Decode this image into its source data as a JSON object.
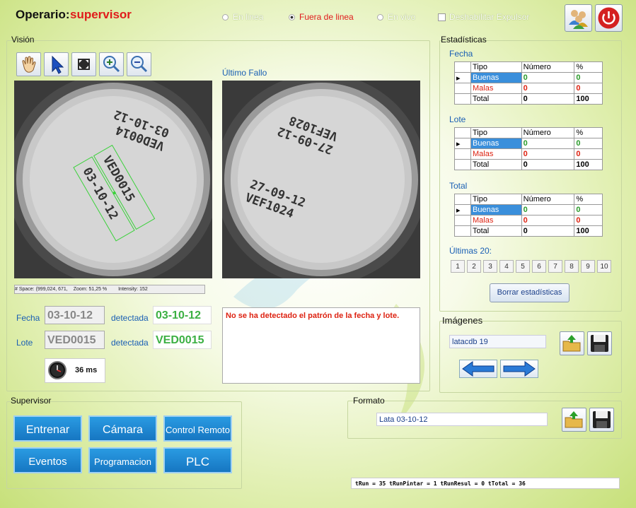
{
  "header": {
    "operator_label": "Operario:",
    "operator_name": "supervisor",
    "radios": [
      {
        "label": "En linea",
        "selected": false
      },
      {
        "label": "Fuera de linea",
        "selected": true
      },
      {
        "label": "En vivo",
        "selected": false
      }
    ],
    "checkbox_label": "Deshabilitar Expulsor"
  },
  "vision": {
    "title": "Visión",
    "last_fail_label": "Último Fallo",
    "status_bar": {
      "space": "# Space: (999,024, 671,",
      "zoom": "Zoom: 51,25 %",
      "intensity": "Intensity: 152"
    },
    "fecha_label": "Fecha",
    "fecha_value": "03-10-12",
    "detectada_label_1": "detectada",
    "fecha_detected": "03-10-12",
    "lote_label": "Lote",
    "lote_value": "VED0015",
    "detectada_label_2": "detectada",
    "lote_detected": "VED0015",
    "time": "36 ms",
    "message": "No se ha detectado el patrón de la fecha y lote."
  },
  "stats": {
    "title": "Estadísticas",
    "headers": [
      "Tipo",
      "Número",
      "%"
    ],
    "sections": [
      {
        "label": "Fecha",
        "rows": [
          [
            "Buenas",
            "0",
            "0"
          ],
          [
            "Malas",
            "0",
            "0"
          ],
          [
            "Total",
            "0",
            "100"
          ]
        ]
      },
      {
        "label": "Lote",
        "rows": [
          [
            "Buenas",
            "0",
            "0"
          ],
          [
            "Malas",
            "0",
            "0"
          ],
          [
            "Total",
            "0",
            "100"
          ]
        ]
      },
      {
        "label": "Total",
        "rows": [
          [
            "Buenas",
            "0",
            "0"
          ],
          [
            "Malas",
            "0",
            "0"
          ],
          [
            "Total",
            "0",
            "100"
          ]
        ]
      }
    ],
    "last20_label": "Últimas 20:",
    "last20": [
      "1",
      "2",
      "3",
      "4",
      "5",
      "6",
      "7",
      "8",
      "9",
      "10"
    ],
    "reset_button": "Borrar estadísticas"
  },
  "images": {
    "title": "Imágenes",
    "current": "latacdb 19"
  },
  "supervisor": {
    "title": "Supervisor",
    "buttons": [
      "Entrenar",
      "Cámara",
      "Control Remoto",
      "Eventos",
      "Programacion",
      "PLC"
    ]
  },
  "format": {
    "title": "Formato",
    "current": "Lata 03-10-12"
  },
  "footer": {
    "timing": "tRun = 35  tRunPintar = 1  tRunResul = 0  tTotal = 36"
  },
  "colors": {
    "accent_blue": "#1a5fb4",
    "operator_red": "#e01b1b",
    "button_blue": "#1676c2",
    "good_green": "#2a9a2a"
  }
}
